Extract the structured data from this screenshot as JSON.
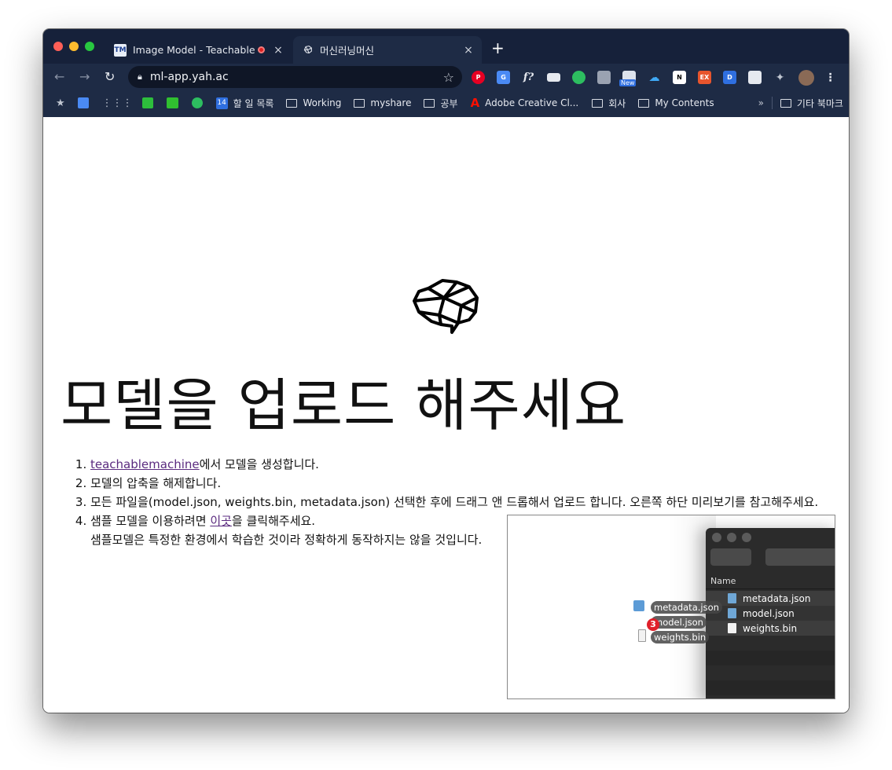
{
  "tabs": [
    {
      "title": "Image Model - Teachable M",
      "favicon": "TM",
      "close": "×"
    },
    {
      "title": "머신러닝머신",
      "favicon": "brain-icon",
      "close": "×"
    }
  ],
  "new_tab": "+",
  "address": {
    "url": "ml-app.yah.ac"
  },
  "extensions": {
    "new_badge": "New",
    "fx_label": "f?"
  },
  "bookmarks": [
    {
      "label": "할 일 목록",
      "icon": "calendar-icon",
      "badge": "14"
    },
    {
      "label": "Working",
      "icon": "folder-icon"
    },
    {
      "label": "myshare",
      "icon": "folder-icon"
    },
    {
      "label": "공부",
      "icon": "folder-icon"
    },
    {
      "label": "Adobe Creative Cl...",
      "icon": "adobe-icon"
    },
    {
      "label": "회사",
      "icon": "folder-icon"
    },
    {
      "label": "My Contents",
      "icon": "folder-icon"
    },
    {
      "label": "기타 북마크",
      "icon": "folder-icon"
    }
  ],
  "bookmark_overflow": "»",
  "page": {
    "heading": "모델을 업로드 해주세요",
    "steps": {
      "s1_link": "teachablemachine",
      "s1_text": "에서 모델을 생성합니다.",
      "s2": "모델의 압축을 해제합니다.",
      "s3": "모든 파일을(model.json, weights.bin, metadata.json) 선택한 후에 드래그 앤 드롭해서 업로드 합니다. 오른쪽 하단 미리보기를 참고해주세요.",
      "s4_pre": "샘플 모델을 이용하려면 ",
      "s4_link": "이곳",
      "s4_post": "을 클릭해주세요.",
      "s4_note": "샘플모델은 특정한 환경에서 학습한 것이라 정확하게 동작하지는 않을 것입니다."
    }
  },
  "preview": {
    "column_header": "Name",
    "files": [
      "metadata.json",
      "model.json",
      "weights.bin"
    ],
    "drag_count": "3"
  },
  "colors": {
    "chrome": "#1e2b45",
    "tabstrip": "#16213a",
    "link": "#5a2a7f"
  }
}
